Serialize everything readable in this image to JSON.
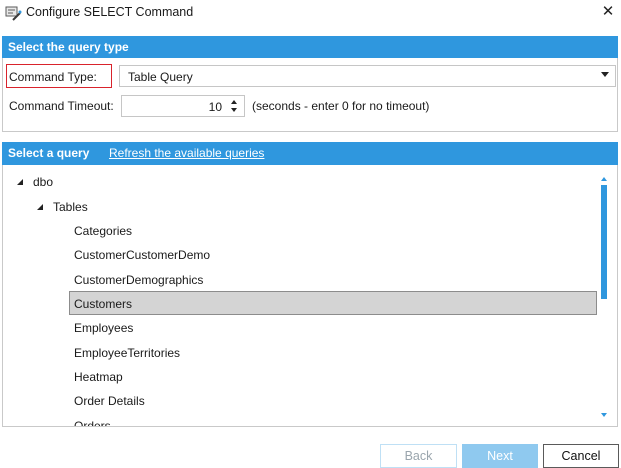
{
  "window": {
    "title": "Configure SELECT Command",
    "close_symbol": "✕"
  },
  "query_type": {
    "header": "Select the query type",
    "command_type_label": "Command Type:",
    "command_type_value": "Table Query",
    "command_timeout_label": "Command Timeout:",
    "command_timeout_value": "10",
    "timeout_hint": "(seconds - enter 0 for no timeout)"
  },
  "select_query": {
    "header": "Select a query",
    "refresh_link": "Refresh the available queries",
    "tree": {
      "root": "dbo",
      "group": "Tables",
      "items": [
        "Categories",
        "CustomerCustomerDemo",
        "CustomerDemographics",
        "Customers",
        "Employees",
        "EmployeeTerritories",
        "Heatmap",
        "Order Details",
        "Orders"
      ],
      "selected": "Customers"
    }
  },
  "buttons": {
    "back": "Back",
    "next": "Next",
    "cancel": "Cancel"
  },
  "colors": {
    "header_blue": "#2f97de",
    "highlight_red": "#d9232c",
    "selected_row": "#d4d4d4"
  }
}
